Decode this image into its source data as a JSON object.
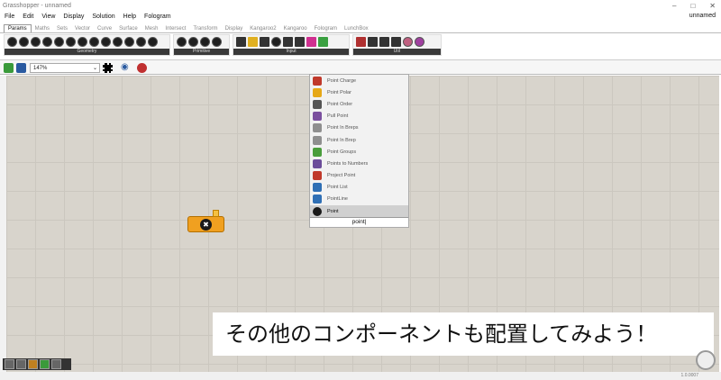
{
  "window": {
    "title": "Grasshopper - unnamed",
    "min": "–",
    "max": "□",
    "close": "✕",
    "user": "unnamed"
  },
  "menu": [
    "File",
    "Edit",
    "View",
    "Display",
    "Solution",
    "Help",
    "Fologram"
  ],
  "tabs": [
    "Params",
    "Maths",
    "Sets",
    "Vector",
    "Curve",
    "Surface",
    "Mesh",
    "Intersect",
    "Transform",
    "Display",
    "Kangaroo2",
    "Kangaroo",
    "Fologram",
    "LunchBox"
  ],
  "ribbon_groups": [
    "Geometry",
    "Primitive",
    "Input",
    "Util"
  ],
  "zoom": "147%",
  "popup": {
    "items": [
      "Point Charge",
      "Point Polar",
      "Point Order",
      "Pull Point",
      "Point In Breps",
      "Point In Brep",
      "Point Groups",
      "Points to Numbers",
      "Project Point",
      "Point List",
      "PointLine",
      "Point"
    ],
    "selected": "Point",
    "query": "point",
    "icon_colors": [
      "#c0392b",
      "#e6a817",
      "#555555",
      "#7a4f9e",
      "#8f8f8f",
      "#8f8f8f",
      "#4a9d3c",
      "#6b4c9a",
      "#c0392b",
      "#2f6fb5",
      "#2f6fb5",
      "#1a1a1a"
    ]
  },
  "component": {
    "glyph": "✖"
  },
  "caption": "その他のコンポーネントも配置してみよう！",
  "status": {
    "version": "1.0.0007"
  }
}
